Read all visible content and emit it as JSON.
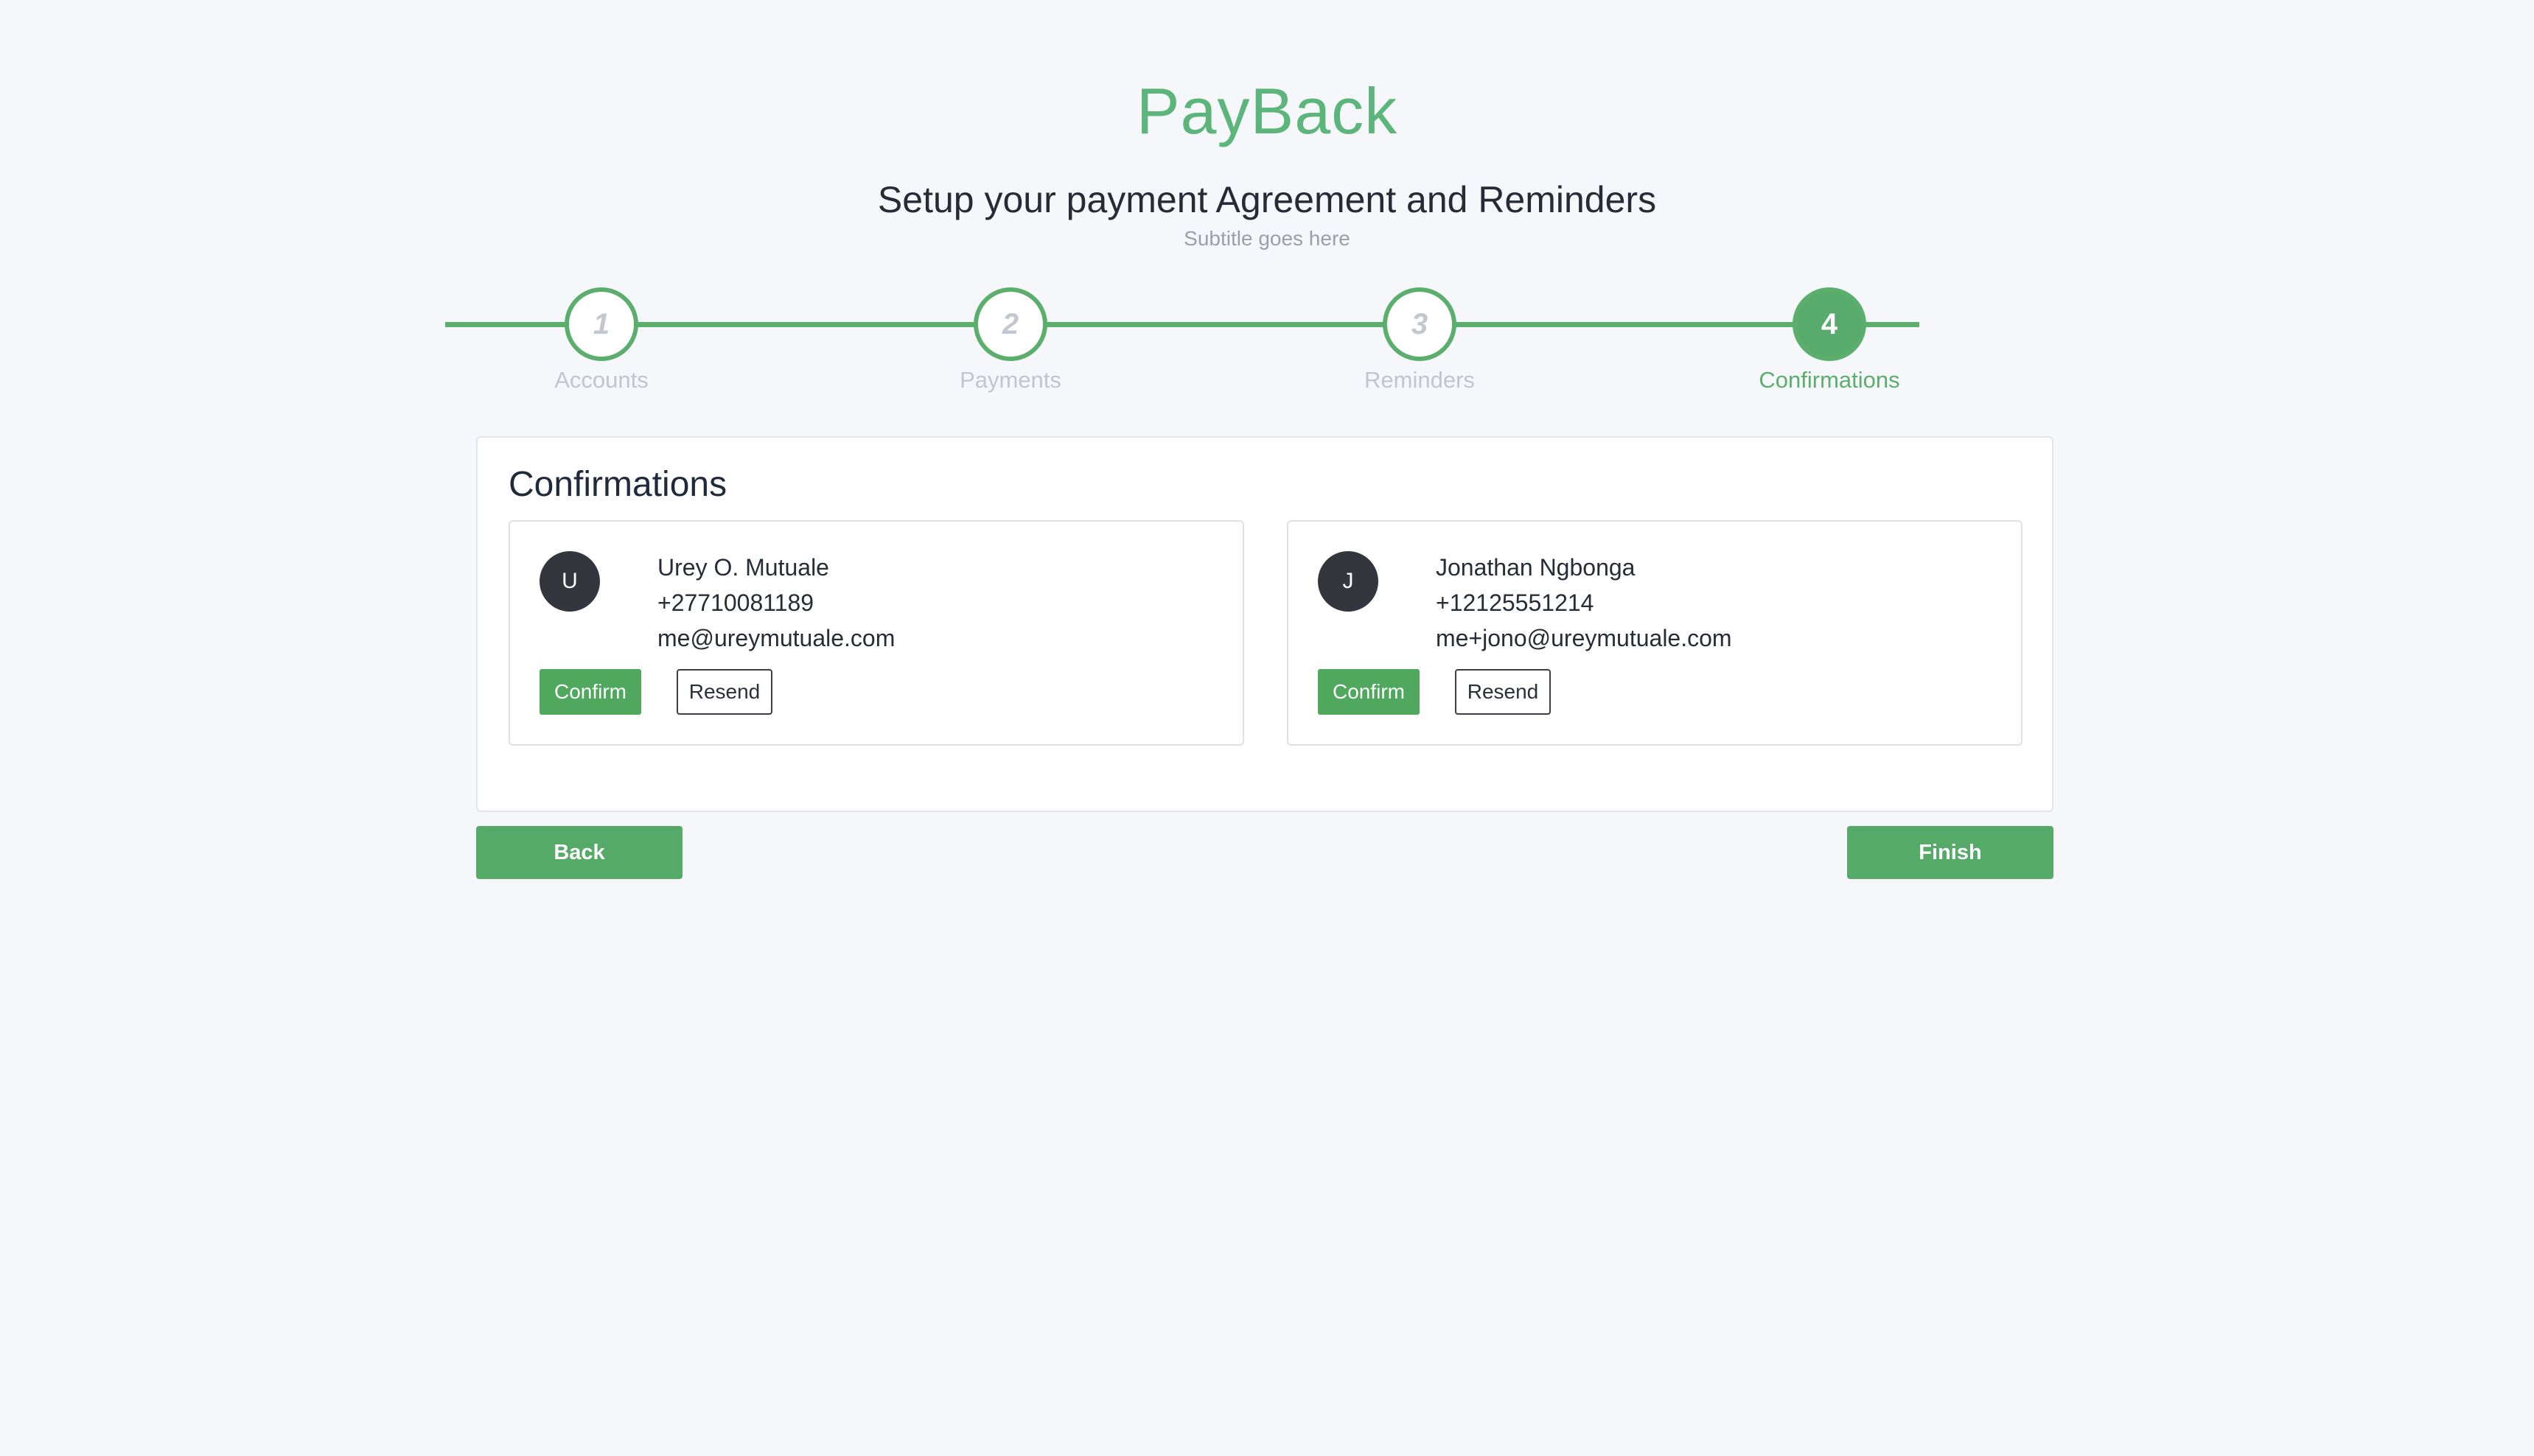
{
  "app": {
    "brand": "PayBack",
    "heading": "Setup your payment Agreement and Reminders",
    "subtitle": "Subtitle goes here"
  },
  "stepper": {
    "active_step": 4,
    "steps": [
      {
        "number": "1",
        "label": "Accounts"
      },
      {
        "number": "2",
        "label": "Payments"
      },
      {
        "number": "3",
        "label": "Reminders"
      },
      {
        "number": "4",
        "label": "Confirmations"
      }
    ]
  },
  "card": {
    "title": "Confirmations",
    "contacts": [
      {
        "initial": "U",
        "name": "Urey O. Mutuale",
        "phone": "+27710081189",
        "email": "me@ureymutuale.com",
        "confirm_label": "Confirm",
        "resend_label": "Resend"
      },
      {
        "initial": "J",
        "name": "Jonathan Ngbonga",
        "phone": "+12125551214",
        "email": "me+jono@ureymutuale.com",
        "confirm_label": "Confirm",
        "resend_label": "Resend"
      }
    ]
  },
  "actions": {
    "back_label": "Back",
    "finish_label": "Finish"
  },
  "colors": {
    "accent": "#5cae6d",
    "button": "#55aa67",
    "brand": "#5cb57a",
    "background": "#f6f7fb",
    "avatar": "#33373d"
  }
}
